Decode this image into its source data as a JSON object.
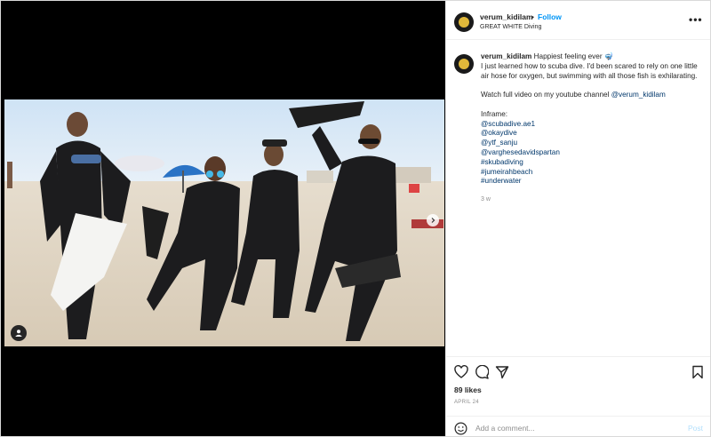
{
  "post": {
    "username": "verum_kidilam",
    "separator": "•",
    "follow_label": "Follow",
    "location": "GREAT WHITE Diving",
    "more_label": "•••"
  },
  "caption": {
    "username": "verum_kidilam",
    "title": "Happiest feeling ever 🤿",
    "body": "I just learned how to scuba dive. I'd been scared to rely on one little air hose for oxygen, but swimming with all those fish is exhilarating.",
    "youtube_text": "Watch full video on my youtube channel",
    "youtube_handle": "@verum_kidilam",
    "inframe_label": "Inframe:",
    "tags": [
      "@scubadive.ae1",
      "@okaydive",
      "@ytf_sanju",
      "@varghesedavidspartan",
      "#skubadiving",
      "#jumeirahbeach",
      "#underwater"
    ],
    "time_ago": "3 w"
  },
  "stats": {
    "likes": "89 likes",
    "date": "APRIL 24"
  },
  "comment": {
    "placeholder": "Add a comment...",
    "post_label": "Post"
  },
  "icons": {
    "like": "heart-icon",
    "comment": "comment-icon",
    "share": "send-icon",
    "save": "bookmark-icon",
    "emoji": "smiley-icon",
    "user_tag": "user-tag-icon",
    "next": "chevron-right-icon"
  },
  "colors": {
    "accent": "#0095f6",
    "link": "#00376b",
    "muted": "#8e8e8e",
    "post_disabled": "#b2dffc"
  }
}
